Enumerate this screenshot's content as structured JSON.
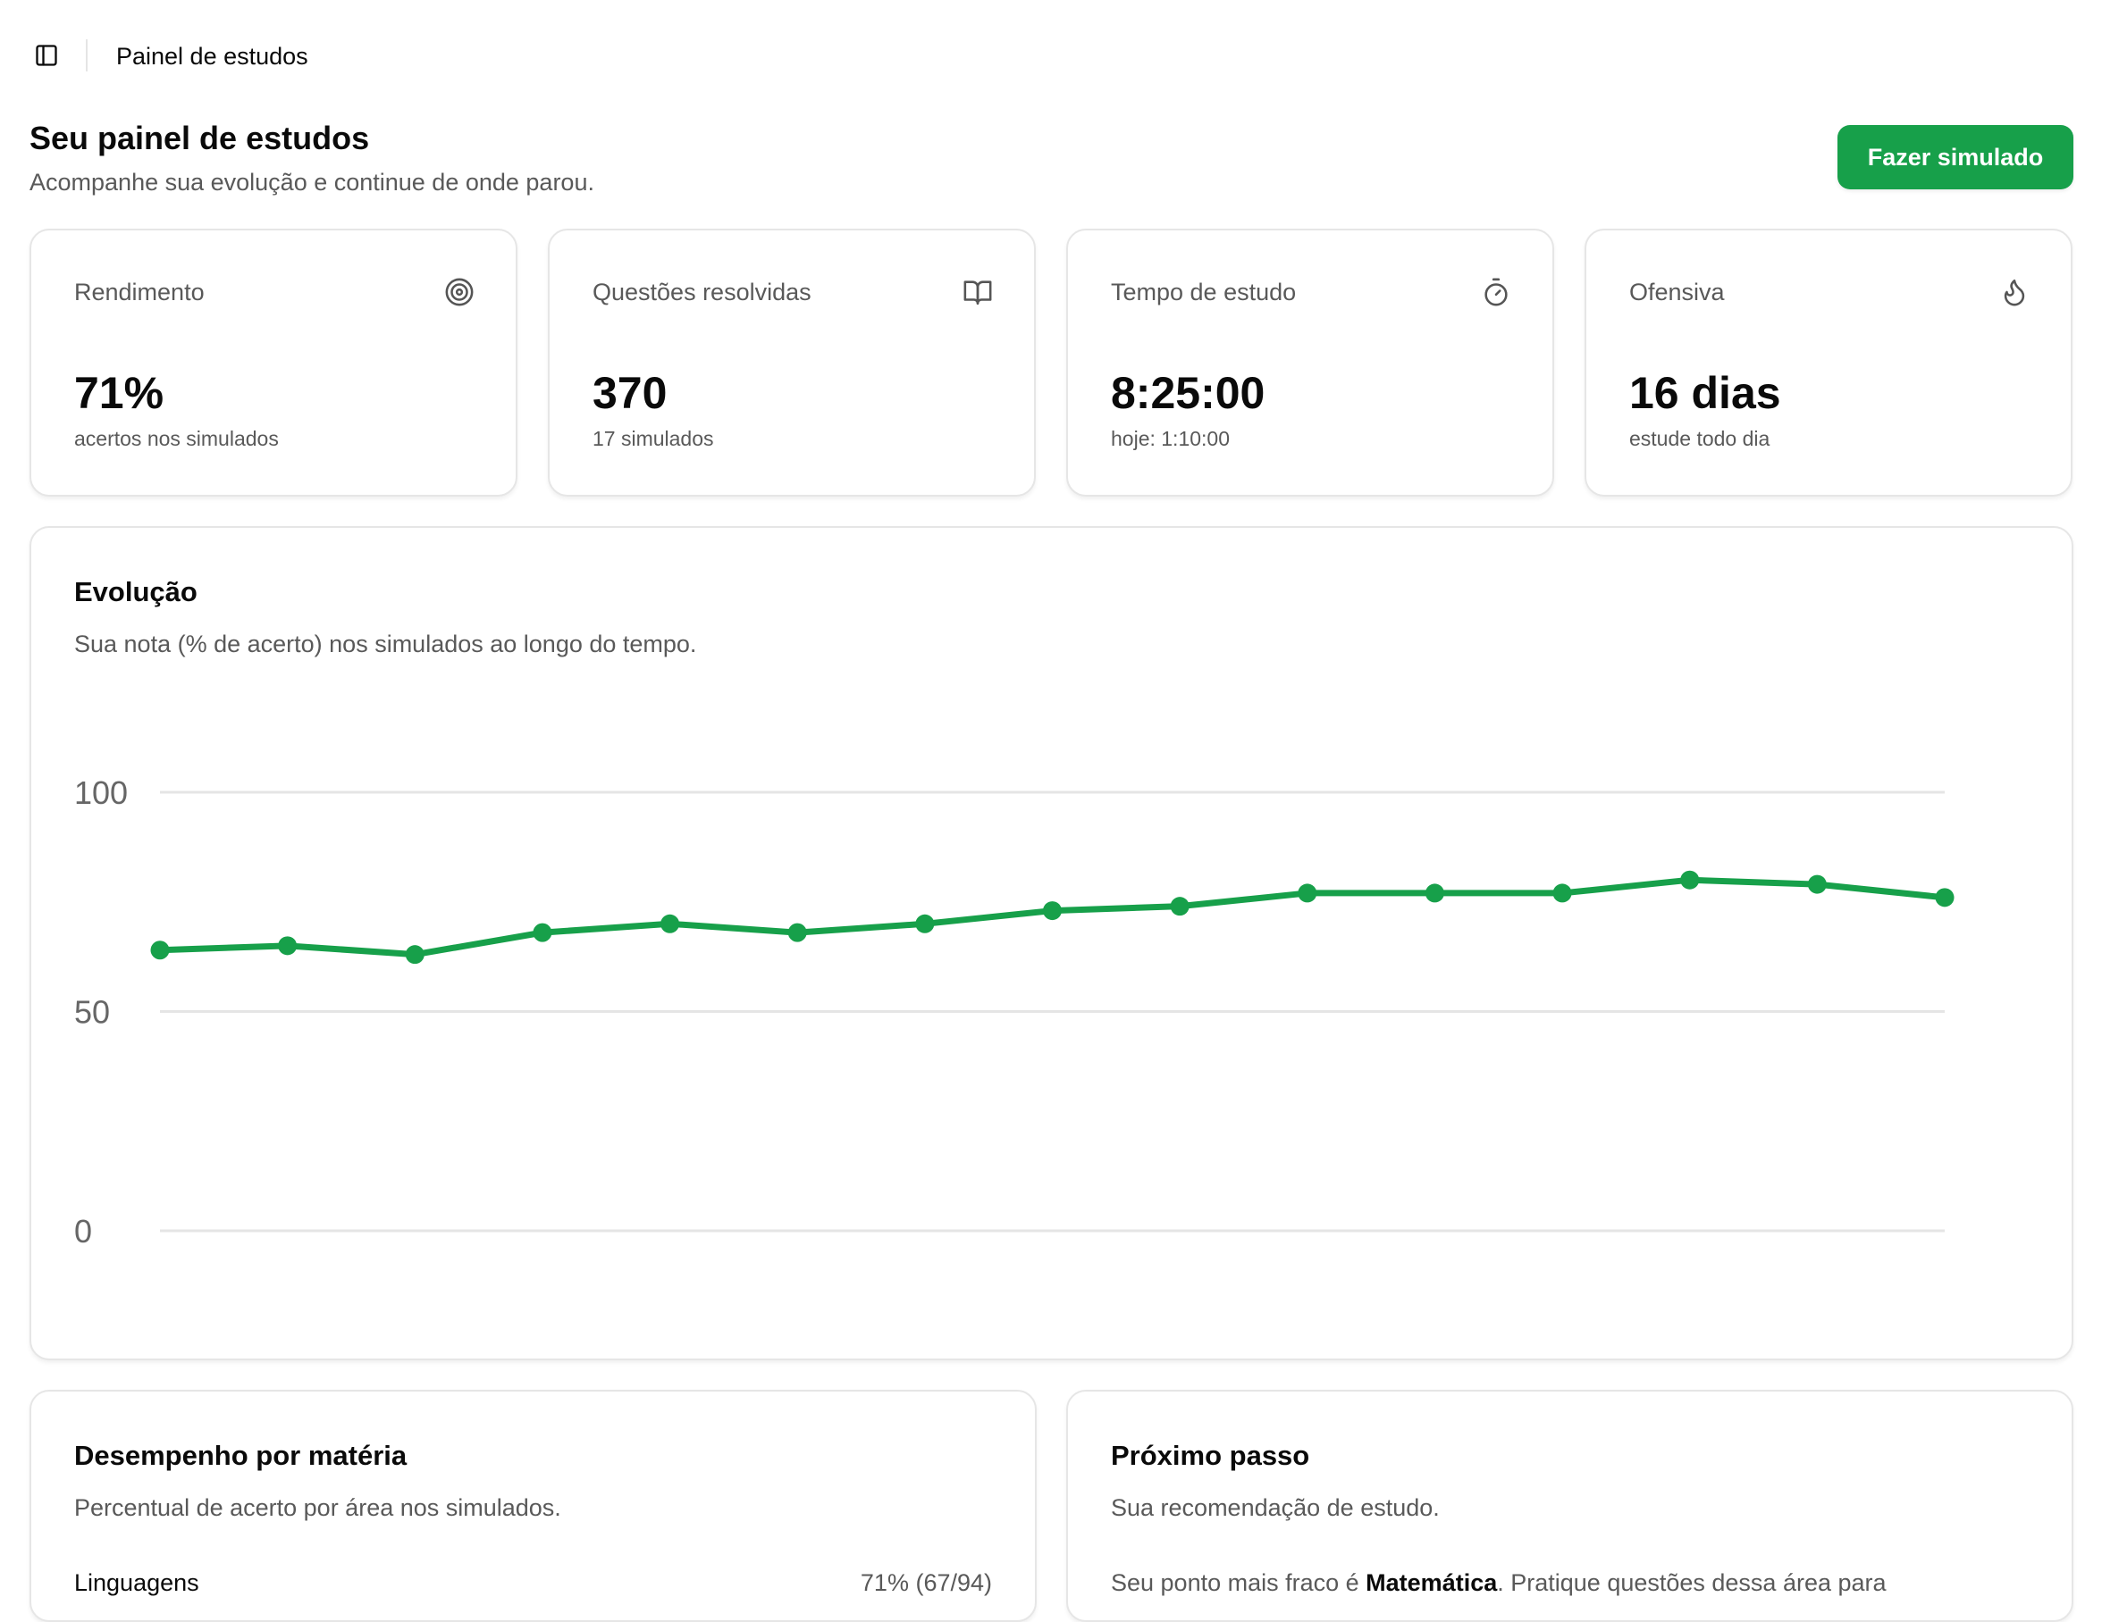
{
  "topbar": {
    "title": "Painel de estudos",
    "toggle_icon": "sidebar-panel-icon"
  },
  "header": {
    "title": "Seu painel de estudos",
    "subtitle": "Acompanhe sua evolução e continue de onde parou.",
    "action_label": "Fazer simulado"
  },
  "stats": [
    {
      "label": "Rendimento",
      "value": "71%",
      "sub": "acertos nos simulados",
      "icon": "target-icon"
    },
    {
      "label": "Questões resolvidas",
      "value": "370",
      "sub": "17 simulados",
      "icon": "open-book-icon"
    },
    {
      "label": "Tempo de estudo",
      "value": "8:25:00",
      "sub": "hoje: 1:10:00",
      "icon": "stopwatch-icon"
    },
    {
      "label": "Ofensiva",
      "value": "16 dias",
      "sub": "estude todo dia",
      "icon": "flame-icon"
    }
  ],
  "evolution": {
    "title": "Evolução",
    "description": "Sua nota (% de acerto) nos simulados ao longo do tempo."
  },
  "chart_data": {
    "type": "line",
    "title": "",
    "xlabel": "",
    "ylabel": "",
    "ylim": [
      0,
      100
    ],
    "yticks": [
      0,
      50,
      100
    ],
    "grid": true,
    "series": [
      {
        "values": [
          64,
          65,
          63,
          68,
          70,
          68,
          70,
          73,
          74,
          77,
          77,
          77,
          80,
          79,
          76
        ]
      }
    ],
    "colors": {
      "line": "#17a04a",
      "grid": "#e5e5e5"
    }
  },
  "subjects": {
    "title": "Desempenho por matéria",
    "description": "Percentual de acerto por área nos simulados.",
    "rows": [
      {
        "label": "Linguagens",
        "value": "71% (67/94)"
      }
    ]
  },
  "next_step": {
    "title": "Próximo passo",
    "description": "Sua recomendação de estudo.",
    "text_before": "Seu ponto mais fraco é ",
    "highlight": "Matemática",
    "text_after": ". Pratique questões dessa área para"
  },
  "colors": {
    "accent": "#17a04a",
    "muted_text": "#595959",
    "border": "#e6e6e6"
  }
}
